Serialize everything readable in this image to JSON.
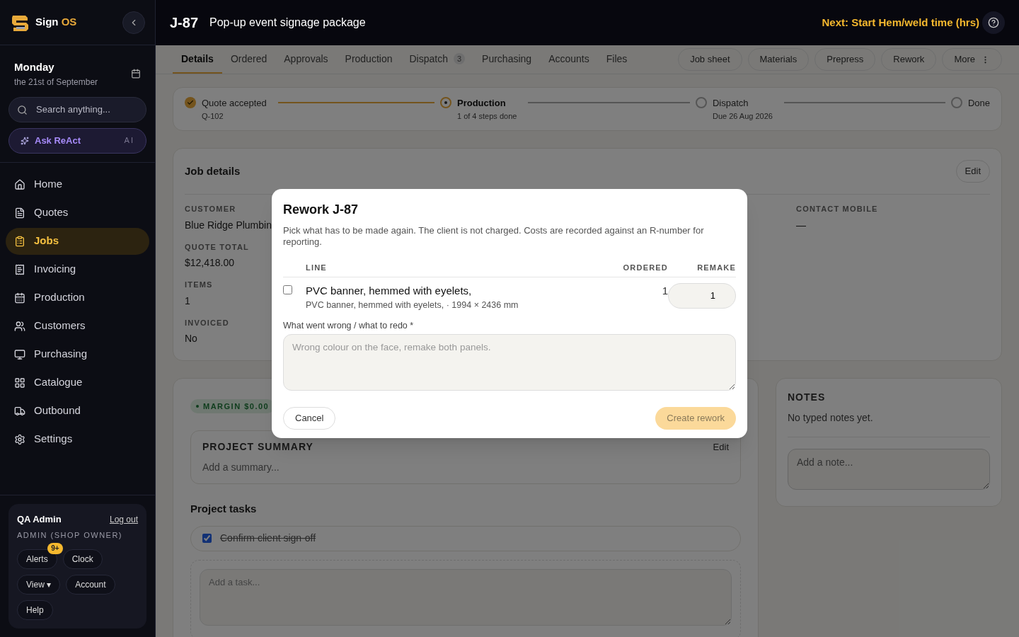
{
  "brand": {
    "word": "Sign",
    "accent": "OS"
  },
  "date": {
    "day": "Monday",
    "date": "the 21st of September"
  },
  "search": {
    "placeholder": "Search anything..."
  },
  "assistant": {
    "label": "Ask ReAct",
    "tag": "AI"
  },
  "nav": [
    {
      "label": "Home",
      "selected": false
    },
    {
      "label": "Quotes",
      "selected": false
    },
    {
      "label": "Jobs",
      "selected": true
    },
    {
      "label": "Invoicing",
      "selected": false
    },
    {
      "label": "Production",
      "selected": false
    },
    {
      "label": "Customers",
      "selected": false
    },
    {
      "label": "Purchasing",
      "selected": false
    },
    {
      "label": "Catalogue",
      "selected": false
    },
    {
      "label": "Outbound",
      "selected": false
    },
    {
      "label": "Settings",
      "selected": false
    }
  ],
  "user": {
    "name": "QA Admin",
    "logout": "Log out",
    "role": "ADMIN (SHOP OWNER)",
    "buttons": [
      {
        "label": "Alerts",
        "badge": "9+"
      },
      {
        "label": "Clock"
      },
      {
        "label": "View ▾"
      },
      {
        "label": "Account"
      },
      {
        "label": "Help"
      }
    ]
  },
  "header": {
    "job": "J-87",
    "title": "Pop-up event signage package",
    "next": "Next: Start Hem/weld time (hrs)"
  },
  "tabs": [
    {
      "label": "Details",
      "selected": true
    },
    {
      "label": "Ordered",
      "selected": false
    },
    {
      "label": "Approvals",
      "selected": false
    },
    {
      "label": "Production",
      "selected": false
    },
    {
      "label": "Dispatch",
      "selected": false,
      "count": "3"
    },
    {
      "label": "Purchasing",
      "selected": false
    },
    {
      "label": "Accounts",
      "selected": false
    },
    {
      "label": "Files",
      "selected": false
    }
  ],
  "actions": [
    {
      "label": "Job sheet"
    },
    {
      "label": "Materials"
    },
    {
      "label": "Prepress"
    },
    {
      "label": "Rework"
    },
    {
      "label": "More",
      "menu": true
    }
  ],
  "steps": [
    {
      "label": "Quote accepted",
      "sub": "Q-102",
      "done": true,
      "current": false
    },
    {
      "label": "Production",
      "sub": "1 of 4 steps done",
      "done": false,
      "current": true
    },
    {
      "label": "Dispatch",
      "sub": "Due 26 Aug 2026",
      "done": false,
      "current": false
    },
    {
      "label": "Done",
      "done": false,
      "current": false
    }
  ],
  "job_details": {
    "title": "Job details",
    "edit": "Edit",
    "left": [
      {
        "label": "CUSTOMER",
        "value": "Blue Ridge Plumbin"
      },
      {
        "label": "QUOTE TOTAL",
        "value": "$12,418.00"
      },
      {
        "label": "ITEMS",
        "value": "1"
      },
      {
        "label": "INVOICED",
        "value": "No"
      }
    ],
    "right": [
      {
        "label": "CONTACT MOBILE",
        "value": "—"
      }
    ]
  },
  "project": {
    "margin": "MARGIN $0.00",
    "summary_title": "PROJECT SUMMARY",
    "summary_edit": "Edit",
    "summary_placeholder": "Add a summary...",
    "tasks_title": "Project tasks",
    "tasks": [
      {
        "label": "Confirm client sign-off",
        "checked": true
      }
    ],
    "task_placeholder": "Add a task..."
  },
  "notes": {
    "title": "NOTES",
    "empty": "No typed notes yet.",
    "placeholder": "Add a note..."
  },
  "dialog": {
    "title": "Rework J-87",
    "description": "Pick what has to be made again. The client is not charged. Costs are recorded against an R-number for reporting.",
    "columns": [
      "LINE",
      "ORDERED",
      "REMAKE"
    ],
    "rows": [
      {
        "checked": false,
        "name": "PVC banner, hemmed with eyelets,",
        "detail": "PVC banner, hemmed with eyelets, · 1994 × 2436 mm",
        "ordered": "1",
        "remake": "1"
      }
    ],
    "reason_label": "What went wrong / what to redo *",
    "reason_placeholder": "Wrong colour on the face, remake both panels.",
    "cancel": "Cancel",
    "submit": "Create rework",
    "submit_disabled": true
  }
}
